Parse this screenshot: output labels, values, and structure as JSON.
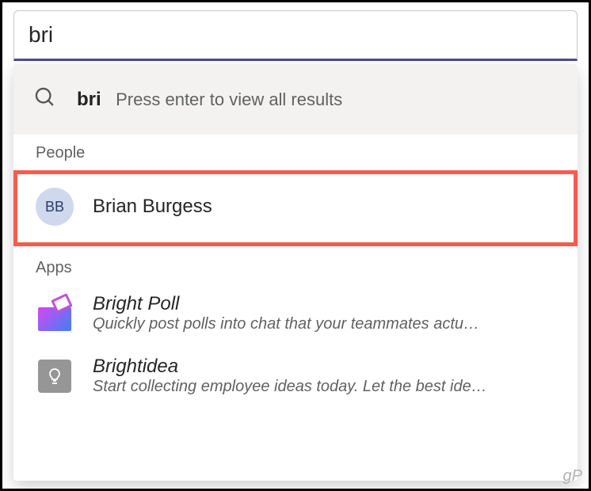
{
  "search": {
    "query": "bri"
  },
  "hint": {
    "query": "bri",
    "text": "Press enter to view all results"
  },
  "sections": {
    "people": {
      "header": "People",
      "items": [
        {
          "initials": "BB",
          "name": "Brian Burgess"
        }
      ]
    },
    "apps": {
      "header": "Apps",
      "items": [
        {
          "name": "Bright Poll",
          "desc": "Quickly post polls into chat that your teammates actu…"
        },
        {
          "name": "Brightidea",
          "desc": "Start collecting employee ideas today. Let the best ide…"
        }
      ]
    }
  },
  "watermark": "gP"
}
